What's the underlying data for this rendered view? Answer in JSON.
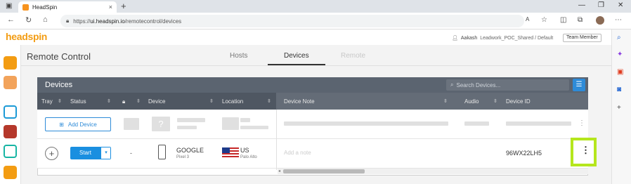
{
  "browser": {
    "tab_title": "HeadSpin",
    "tab_close": "×",
    "new_tab": "+",
    "url_prefix": "https://",
    "url_host": "ui.headspin.io",
    "url_path": "/remotecontrol/devices"
  },
  "app": {
    "logo": "headspin",
    "user_name": "Aakash",
    "user_org": "Leadwork_POC_Shared / Default",
    "role_badge": "Team Member"
  },
  "remote_control": {
    "title": "Remote Control",
    "tabs": [
      {
        "label": "Hosts",
        "state": "normal"
      },
      {
        "label": "Devices",
        "state": "active"
      },
      {
        "label": "Remote",
        "state": "disabled"
      }
    ]
  },
  "devices_panel": {
    "title": "Devices",
    "search_placeholder": "Search Devices...",
    "columns": [
      "Tray",
      "Status",
      "Device",
      "Location",
      "Device Note",
      "Audio",
      "Device ID"
    ],
    "add_device_label": "Add Device",
    "rows": [
      {
        "status_button": "Start",
        "lock": "-",
        "device_name": "GOOGLE",
        "device_model": "Pixel 3",
        "country": "US",
        "city": "Palo Alto",
        "note_placeholder": "Add a note",
        "device_id": "96WX22LH5"
      }
    ]
  },
  "colors": {
    "accent": "#1a8fe0",
    "brand": "#f39c12",
    "highlight": "#b5e61d",
    "header": "#5b6470"
  }
}
